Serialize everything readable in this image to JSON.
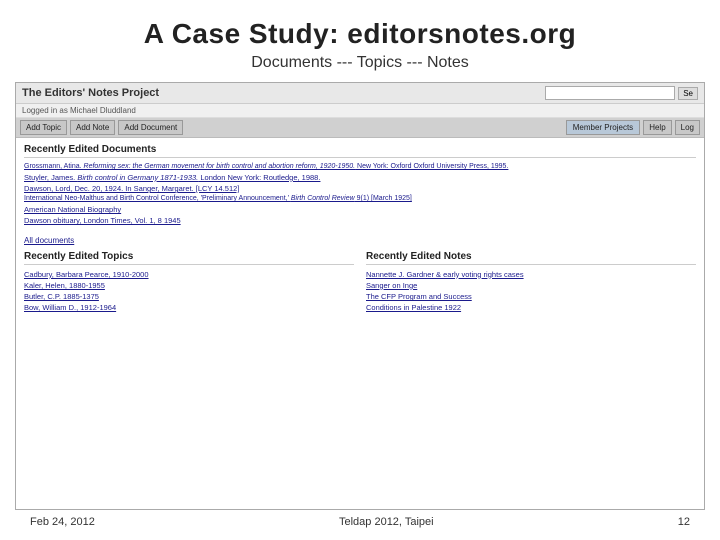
{
  "slide": {
    "title": "A Case Study:  editorsnotes.org",
    "subtitle": "Documents --- Topics  ---  Notes"
  },
  "browser": {
    "site_title": "The Editors' Notes Project",
    "search_placeholder": "",
    "search_btn_label": "Se",
    "logged_in_text": "Logged in as Michael Dluddland",
    "nav_buttons": [
      "Add Topic",
      "Add Note",
      "Add Document"
    ],
    "nav_right_buttons": [
      "Member Projects",
      "Help",
      "Log"
    ],
    "recently_edited_docs_title": "Recently Edited Documents",
    "documents": [
      "Grossmann, Atina. Reforming sex: the German movement for birth control and abortion reform, 1920-1950. New York: Oxford  Oxford University Press, 1995.",
      "Stuyler, James. Birth control in Germany 1871-1933. London  New York: Routledge, 1988.",
      "Dawson, Lord, Dec. 20, 1924. In Sanger, Margaret. [LCY 14.512]",
      "International Neo-Malthus and Birth Control Conference, 'Preliminary Announcement,' Birth Control Review 9(1) [March 1925]",
      "American National Biography",
      "Dawson obituary, London Times, Vol. 1, 8 1945"
    ],
    "all_docs_link": "All documents",
    "recently_edited_topics_title": "Recently Edited Topics",
    "topics": [
      "Cadbury, Barbara Pearce, 1910-2000",
      "Kaler, Helen, 1880-1955",
      "Butler, C.P. 1885-1975",
      "Bow, William D., 1912-1964"
    ],
    "recently_edited_notes_title": "Recently Edited Notes",
    "notes": [
      "Nannette J. Gardner & early voting rights cases",
      "Sanger on Inge",
      "The CFP Program and Success",
      "Conditions in Palestine 1922"
    ]
  },
  "footer": {
    "left": "Feb  24, 2012",
    "center": "Teldap 2012, Taipei",
    "right": "12"
  }
}
